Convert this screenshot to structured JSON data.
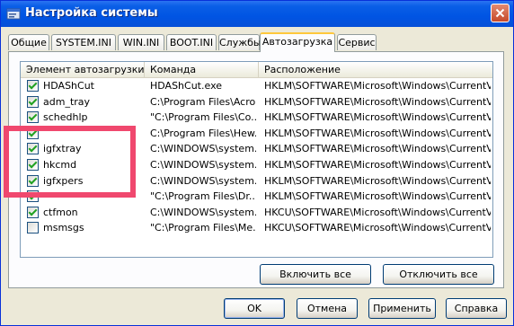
{
  "window": {
    "title": "Настройка системы"
  },
  "tabs": [
    {
      "label": "Общие"
    },
    {
      "label": "SYSTEM.INI"
    },
    {
      "label": "WIN.INI"
    },
    {
      "label": "BOOT.INI"
    },
    {
      "label": "Службы"
    },
    {
      "label": "Автозагрузка",
      "active": true
    },
    {
      "label": "Сервис"
    }
  ],
  "list": {
    "columns": [
      "Элемент автозагрузки",
      "Команда",
      "Расположение"
    ],
    "rows": [
      {
        "checked": true,
        "name": "HDAShCut",
        "command": "HDAShCut.exe",
        "location": "HKLM\\SOFTWARE\\Microsoft\\Windows\\CurrentVer..."
      },
      {
        "checked": true,
        "name": "adm_tray",
        "command": "C:\\Program Files\\Acro...",
        "location": "HKLM\\SOFTWARE\\Microsoft\\Windows\\CurrentVer..."
      },
      {
        "checked": true,
        "name": "schedhlp",
        "command": "\"C:\\Program Files\\Co...",
        "location": "HKLM\\SOFTWARE\\Microsoft\\Windows\\CurrentVer..."
      },
      {
        "checked": true,
        "name": "",
        "command": "C:\\Program Files\\Hew...",
        "location": "HKLM\\SOFTWARE\\Microsoft\\Windows\\CurrentVer..."
      },
      {
        "checked": true,
        "name": "igfxtray",
        "command": "C:\\WINDOWS\\system...",
        "location": "HKLM\\SOFTWARE\\Microsoft\\Windows\\CurrentVer..."
      },
      {
        "checked": true,
        "name": "hkcmd",
        "command": "C:\\WINDOWS\\system...",
        "location": "HKLM\\SOFTWARE\\Microsoft\\Windows\\CurrentVer..."
      },
      {
        "checked": true,
        "name": "igfxpers",
        "command": "C:\\WINDOWS\\system...",
        "location": "HKLM\\SOFTWARE\\Microsoft\\Windows\\CurrentVer..."
      },
      {
        "checked": true,
        "name": "",
        "command": "\"C:\\Program Files\\Dr...",
        "location": "HKLM\\SOFTWARE\\Microsoft\\Windows\\CurrentVer..."
      },
      {
        "checked": true,
        "name": "ctfmon",
        "command": "C:\\WINDOWS\\system...",
        "location": "HKCU\\SOFTWARE\\Microsoft\\Windows\\CurrentVer..."
      },
      {
        "checked": false,
        "name": "msmsgs",
        "command": "\"C:\\Program Files\\Me...",
        "location": "HKCU\\SOFTWARE\\Microsoft\\Windows\\CurrentVer..."
      }
    ]
  },
  "panel_buttons": {
    "enable_all": "Включить все",
    "disable_all": "Отключить все"
  },
  "dialog_buttons": {
    "ok": "OK",
    "cancel": "Отмена",
    "apply": "Применить",
    "help": "Справка"
  },
  "colors": {
    "title_bar": "#0054e3",
    "highlight_frame": "#f0486e",
    "dialog_bg": "#ece9d8"
  }
}
